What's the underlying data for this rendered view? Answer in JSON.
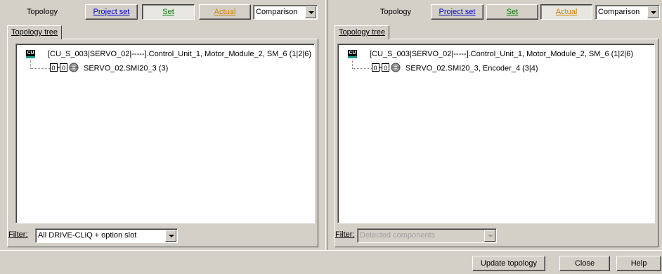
{
  "left_pane": {
    "toolbar": {
      "label": "Topology",
      "project_set": "Project set",
      "set": "Set",
      "actual": "Actual",
      "view_select": "Comparison"
    },
    "tab": "Topology tree",
    "tree": {
      "root": "[CU_S_003|SERVO_02|-----].Control_Unit_1, Motor_Module_2, SM_6 (1|2|6)",
      "child": "SERVO_02.SMI20_3 (3)"
    },
    "filter": {
      "label": "Filter:",
      "value": "All DRIVE-CLiQ + option slot",
      "enabled": true
    },
    "active_mode": "Set"
  },
  "right_pane": {
    "toolbar": {
      "label": "Topology",
      "project_set": "Project set",
      "set": "Set",
      "actual": "Actual",
      "view_select": "Comparison"
    },
    "tab": "Topology tree",
    "tree": {
      "root": "[CU_S_003|SERVO_02|-----].Control_Unit_1, Motor_Module_2, SM_6 (1|2|6)",
      "child": "SERVO_02.SMI20_3, Encoder_4 (3|4)"
    },
    "filter": {
      "label": "Filter:",
      "value": "Detected components",
      "enabled": false
    },
    "active_mode": "Actual"
  },
  "icons": {
    "cu": "CU",
    "module_digit": "0"
  },
  "footer": {
    "update_topology": "Update topology",
    "close": "Close",
    "help": "Help"
  },
  "colors": {
    "project_set": "#0000cc",
    "set": "#007a00",
    "actual": "#d08000",
    "background": "#d4d0c8"
  }
}
